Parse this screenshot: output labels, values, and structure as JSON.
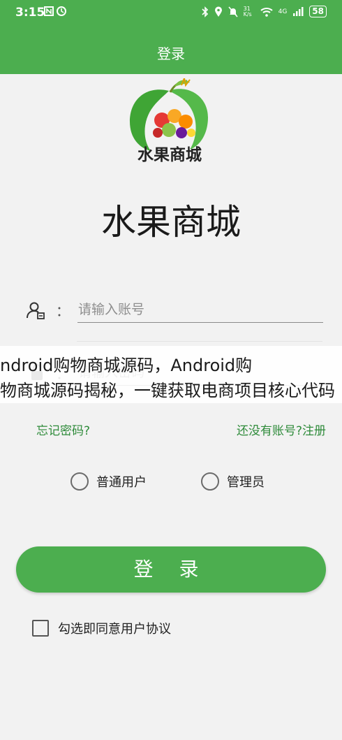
{
  "status_bar": {
    "time": "3:15",
    "signal_speed": "31 K/s",
    "network": "4G",
    "battery": "58"
  },
  "app_bar": {
    "title": "登录"
  },
  "logo": {
    "text": "水果商城"
  },
  "app_name": "水果商城",
  "form": {
    "account_placeholder": "请输入账号",
    "password_placeholder": "请输入密码",
    "colon": "："
  },
  "overlay": {
    "line1": "ndroid购物商城源码，Android购",
    "line2": "物商城源码揭秘，一键获取电商项目核心代码"
  },
  "links": {
    "forgot": "忘记密码?",
    "register": "还没有账号?注册"
  },
  "roles": {
    "user": "普通用户",
    "admin": "管理员"
  },
  "login_button": "登 录",
  "agreement": "勾选即同意用户协议",
  "colors": {
    "primary": "#4cae4f",
    "link": "#2e8b3a"
  }
}
